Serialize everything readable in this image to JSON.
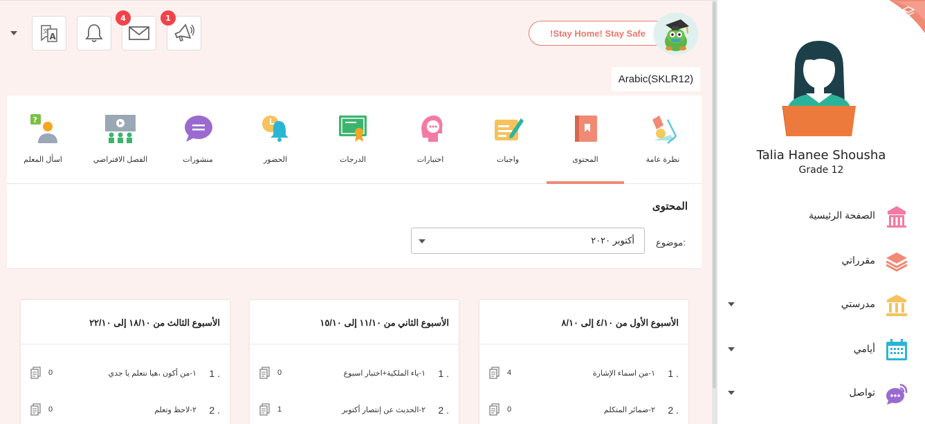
{
  "topbar": {
    "stay_home": "!Stay Home! Stay Safe",
    "messages_badge": "4",
    "announcements_badge": "1",
    "course_label": "Arabic(SKLR12)",
    "icons": [
      "translate-icon",
      "bell-icon",
      "envelope-icon",
      "megaphone-icon",
      "dropdown-caret-icon"
    ]
  },
  "tabs": [
    {
      "label": "نظرة عامة",
      "icon": "lamp-icon"
    },
    {
      "label": "المحتوى",
      "icon": "book-icon",
      "active": true
    },
    {
      "label": "واجبات",
      "icon": "pen-paper-icon"
    },
    {
      "label": "اختبارات",
      "icon": "head-dots-icon"
    },
    {
      "label": "الدرجات",
      "icon": "certificate-icon"
    },
    {
      "label": "الحضور",
      "icon": "bell-clock-icon"
    },
    {
      "label": "منشورات",
      "icon": "chat-bubble-icon"
    },
    {
      "label": "الفصل الافتراضي",
      "icon": "virtual-class-icon"
    },
    {
      "label": "اسأل المعلم",
      "icon": "ask-teacher-icon"
    }
  ],
  "content": {
    "title": "المحتوى",
    "topic_label": "موضوع:",
    "topic_value": "أكتوبر ٢٠٢٠"
  },
  "weeks": [
    {
      "title": "الأسبوع الأول من ٤/١٠ إلى ٨/١٠",
      "items": [
        {
          "num": "1 .",
          "name": "١-من اسماء الإشارة",
          "count": "4"
        },
        {
          "num": "2 .",
          "name": "٢-ضمائر المتكلم",
          "count": "0"
        }
      ]
    },
    {
      "title": "الأسبوع الثاني من ١١/١٠ إلى ١٥/١٠",
      "items": [
        {
          "num": "1 .",
          "name": "١-ياء الملكية+اختبار اسبوع",
          "count": "0"
        },
        {
          "num": "2 .",
          "name": "٢-الحديث عن إنتصار أكتوبر",
          "count": "1"
        }
      ]
    },
    {
      "title": "الأسبوع الثالث من ١٨/١٠ إلى ٢٢/١٠",
      "items": [
        {
          "num": "1 .",
          "name": "١-من أكون ،هيا نتعلم يا جدي",
          "count": "0"
        },
        {
          "num": "2 .",
          "name": "٢-لاحظ وتعلم",
          "count": "0"
        }
      ]
    }
  ],
  "sidebar": {
    "user_name": "Talia Hanee Shousha",
    "grade": "Grade 12",
    "nav": [
      {
        "label": "الصفحة الرئيسية",
        "icon": "school-building-icon",
        "has_caret": false
      },
      {
        "label": "مقرراتي",
        "icon": "layers-icon",
        "has_caret": false
      },
      {
        "label": "مدرستي",
        "icon": "institution-icon",
        "has_caret": true
      },
      {
        "label": "أيامي",
        "icon": "calendar-icon",
        "has_caret": true
      },
      {
        "label": "تواصل",
        "icon": "chat-icon",
        "has_caret": true
      }
    ]
  },
  "colors": {
    "accent": "#f08a75",
    "badge": "#f0434b",
    "background": "#fdf1ef"
  }
}
